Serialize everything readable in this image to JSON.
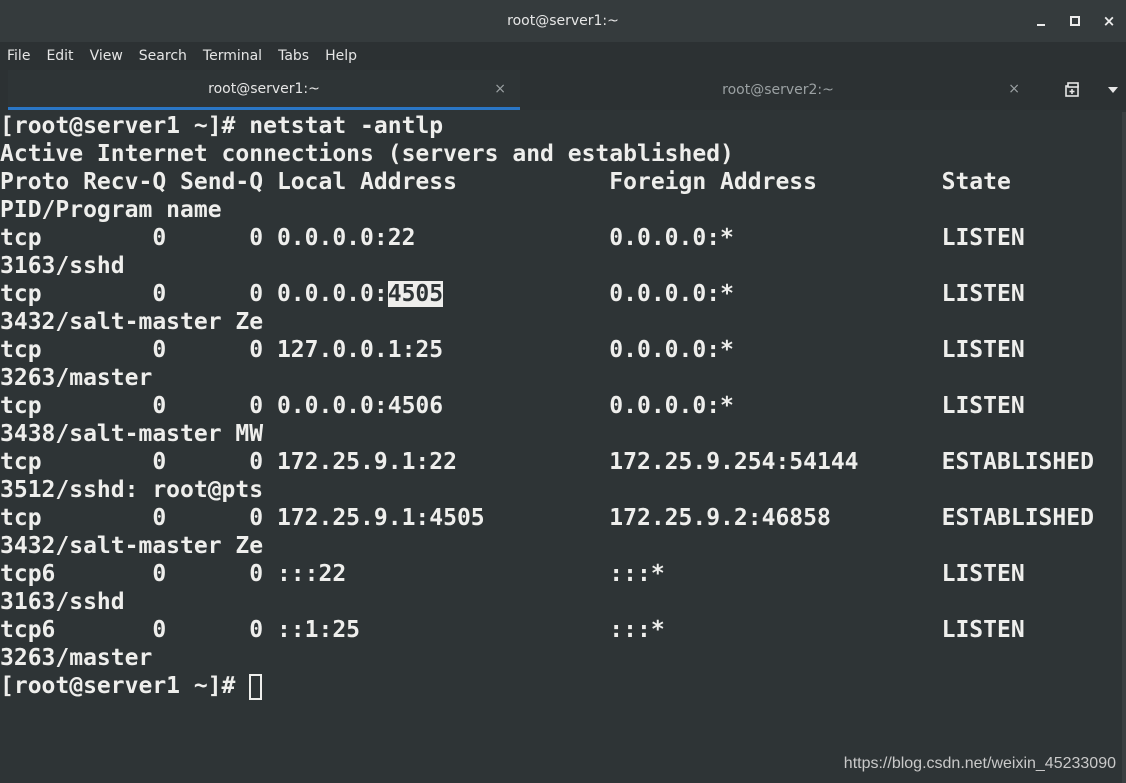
{
  "window": {
    "title": "root@server1:~"
  },
  "menu": [
    "File",
    "Edit",
    "View",
    "Search",
    "Terminal",
    "Tabs",
    "Help"
  ],
  "tabs": [
    {
      "label": "root@server1:~",
      "active": true
    },
    {
      "label": "root@server2:~",
      "active": false
    }
  ],
  "icons": {
    "close": "×",
    "minimize": "minimize-icon",
    "maximize": "maximize-icon",
    "new_tab": "new-tab-icon",
    "tab_menu": "chevron-down-icon"
  },
  "terminal": {
    "lines": [
      "[root@server1 ~]# netstat -antlp",
      "Active Internet connections (servers and established)",
      "Proto Recv-Q Send-Q Local Address           Foreign Address         State",
      "PID/Program name",
      "tcp        0      0 0.0.0.0:22              0.0.0.0:*               LISTEN",
      "3163/sshd",
      "tcp        0      0 0.0.0.0:",
      "3432/salt-master Ze",
      "tcp        0      0 127.0.0.1:25            0.0.0.0:*               LISTEN",
      "3263/master",
      "tcp        0      0 0.0.0.0:4506            0.0.0.0:*               LISTEN",
      "3438/salt-master MW",
      "tcp        0      0 172.25.9.1:22           172.25.9.254:54144      ESTABLISHED",
      "3512/sshd: root@pts",
      "tcp        0      0 172.25.9.1:4505         172.25.9.2:46858        ESTABLISHED",
      "3432/salt-master Ze",
      "tcp6       0      0 :::22                   :::*                    LISTEN",
      "3163/sshd",
      "tcp6       0      0 ::1:25                  :::*                    LISTEN",
      "3263/master",
      "[root@server1 ~]# "
    ],
    "highlight_text": "4505",
    "highlight_after": "            0.0.0.0:*               LISTEN"
  },
  "watermark": "https://blog.csdn.net/weixin_45233090",
  "colors": {
    "background": "#2e3436",
    "foreground": "#eeeeec",
    "tab_accent": "#2a76c6"
  }
}
